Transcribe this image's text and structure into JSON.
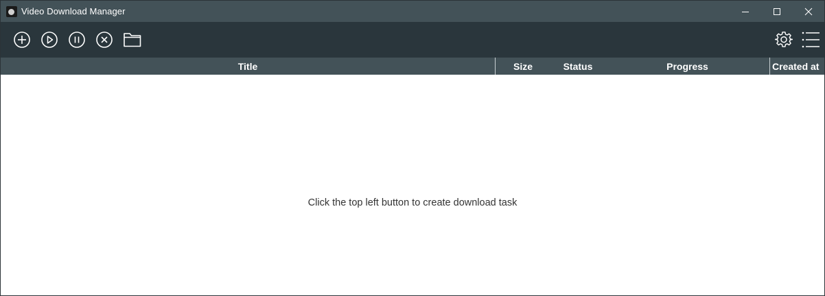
{
  "window": {
    "title": "Video Download Manager"
  },
  "titlebar_controls": {
    "minimize_icon": "minimize-icon",
    "maximize_icon": "maximize-icon",
    "close_icon": "close-icon"
  },
  "toolbar": {
    "left_icons": [
      "add-circle-icon",
      "play-circle-icon",
      "pause-circle-icon",
      "cancel-circle-icon",
      "folder-icon"
    ],
    "right_icons": [
      "gear-icon",
      "list-menu-icon"
    ]
  },
  "table": {
    "columns": [
      "Title",
      "Size",
      "Status",
      "Progress",
      "Created at"
    ]
  },
  "empty_state": {
    "message": "Click the top left button to create download task"
  },
  "colors": {
    "titlebar": "#435258",
    "toolbar": "#2a363c",
    "header": "#435258",
    "background": "#ffffff",
    "icon": "#ffffff"
  }
}
